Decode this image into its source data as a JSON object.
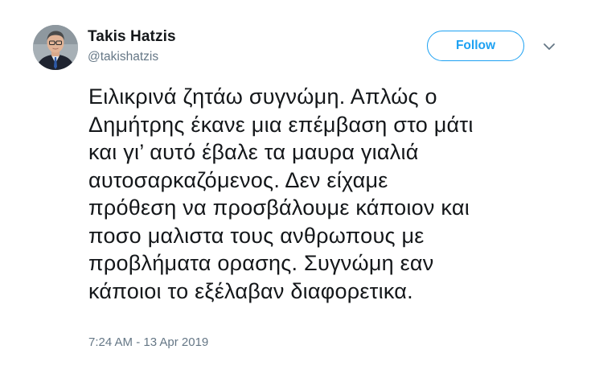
{
  "author": {
    "display_name": "Takis Hatzis",
    "handle": "@takishatzis",
    "avatar_icon": "profile-photo"
  },
  "follow_button": {
    "label": "Follow",
    "color": "#1da1f2"
  },
  "menu_icon": "chevron-down-icon",
  "tweet": {
    "lines": [
      "Ειλικρινά ζητάω συγνώμη. Απλώς ο",
      "Δημήτρης έκανε μια επέμβαση στο μάτι",
      "και γι’ αυτό έβαλε τα μαυρα γιαλιά",
      "αυτοσαρκαζόμενος. Δεν είχαμε",
      "πρόθεση να προσβάλουμε κάποιον και",
      "ποσο μαλιστα τους ανθρωπους με",
      "προβλήματα ορασης. Συγνώμη εαν",
      "κάποιοι το εξέλαβαν διαφορετικα."
    ],
    "timestamp": "7:24 AM - 13 Apr 2019"
  }
}
